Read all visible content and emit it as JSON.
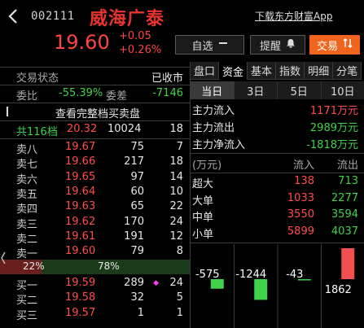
{
  "header": {
    "code": "002111",
    "name": "威海广泰",
    "download_link": "下载东方财富App",
    "price": "19.60",
    "change_abs": "+0.05",
    "change_pct": "+0.26%",
    "watch_label": "自选",
    "alert_label": "提醒",
    "trade_label": "交易"
  },
  "status": {
    "label": "交易状态",
    "value": "已收市"
  },
  "ratio": {
    "wb_label": "委比",
    "wb_value": "-55.39%",
    "wc_label": "委差",
    "wc_value": "-7146"
  },
  "full_book_link": "查看完整档买卖盘",
  "summary": {
    "label": "共116档",
    "price": "20.32",
    "volume": "10024",
    "count": "18"
  },
  "asks": [
    {
      "label": "卖八",
      "price": "19.67",
      "volume": "75",
      "count": "7"
    },
    {
      "label": "卖七",
      "price": "19.66",
      "volume": "217",
      "count": "18"
    },
    {
      "label": "卖六",
      "price": "19.65",
      "volume": "97",
      "count": "14"
    },
    {
      "label": "卖五",
      "price": "19.64",
      "volume": "60",
      "count": "10"
    },
    {
      "label": "卖四",
      "price": "19.63",
      "volume": "65",
      "count": "22"
    },
    {
      "label": "卖三",
      "price": "19.62",
      "volume": "170",
      "count": "24"
    },
    {
      "label": "卖二",
      "price": "19.61",
      "volume": "191",
      "count": "12"
    },
    {
      "label": "卖一",
      "price": "19.60",
      "volume": "79",
      "count": "8"
    }
  ],
  "bid_ask_bar": {
    "bid_pct_label": "22%",
    "ask_pct_label": "78%",
    "bid_fraction": 0.22
  },
  "bids": [
    {
      "label": "买一",
      "price": "19.59",
      "volume": "289",
      "count": "24"
    },
    {
      "label": "买二",
      "price": "19.58",
      "volume": "32",
      "count": "5"
    },
    {
      "label": "买三",
      "price": "19.57",
      "volume": "1",
      "count": "1"
    }
  ],
  "tabs": [
    {
      "label": "盘口",
      "active": false
    },
    {
      "label": "资金",
      "active": true
    },
    {
      "label": "基本",
      "active": false
    },
    {
      "label": "指数",
      "active": false
    },
    {
      "label": "明细",
      "active": false
    },
    {
      "label": "分笔",
      "active": false
    }
  ],
  "subtabs": [
    {
      "label": "当日",
      "active": true
    },
    {
      "label": "3日",
      "active": false
    },
    {
      "label": "5日",
      "active": false
    },
    {
      "label": "10日",
      "active": false
    }
  ],
  "main_flow": [
    {
      "label": "主力流入",
      "value": "1171万元",
      "color": "#ff4d4d"
    },
    {
      "label": "主力流出",
      "value": "2989万元",
      "color": "#3fd24a"
    },
    {
      "label": "主力净流入",
      "value": "-1818万元",
      "color": "#3fd24a"
    }
  ],
  "flow_table": {
    "unit_label": "(万元)",
    "in_label": "流入",
    "out_label": "流出",
    "rows": [
      {
        "label": "超大",
        "in": "138",
        "out": "713"
      },
      {
        "label": "大单",
        "in": "1033",
        "out": "2277"
      },
      {
        "label": "中单",
        "in": "3550",
        "out": "3594"
      },
      {
        "label": "小单",
        "in": "5899",
        "out": "4037"
      }
    ]
  },
  "chart_data": {
    "type": "bar",
    "categories": [
      "超大",
      "大单",
      "中单",
      "小单"
    ],
    "values": [
      -575,
      -1244,
      -43,
      1862
    ],
    "labels": [
      "-575",
      "-1244",
      "-43",
      "1862"
    ],
    "colors": {
      "positive": "#f05050",
      "negative": "#3fd24a"
    }
  }
}
